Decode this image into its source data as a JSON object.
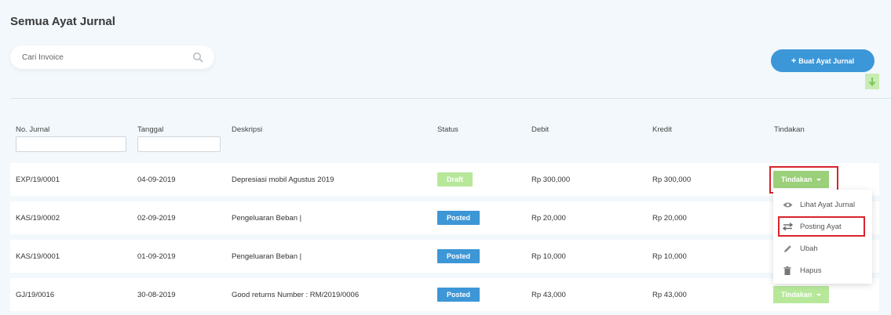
{
  "page": {
    "title": "Semua Ayat Jurnal"
  },
  "search": {
    "placeholder": "Cari Invoice",
    "icon": "search-icon"
  },
  "toolbar": {
    "create_label": "Buat Ayat Jurnal",
    "download_icon": "arrow-down-icon"
  },
  "table": {
    "columns": [
      "No. Jurnal",
      "Tanggal",
      "Deskripsi",
      "Status",
      "Debit",
      "Kredit",
      "Tindakan"
    ],
    "rows": [
      {
        "no": "EXP/19/0001",
        "date": "04-09-2019",
        "desc": "Depresiasi mobil Agustus 2019",
        "status": "Draft",
        "debit": "Rp 300,000",
        "credit": "Rp 300,000",
        "action": "Tindakan"
      },
      {
        "no": "KAS/19/0002",
        "date": "02-09-2019",
        "desc": "Pengeluaran Beban |",
        "status": "Posted",
        "debit": "Rp 20,000",
        "credit": "Rp 20,000"
      },
      {
        "no": "KAS/19/0001",
        "date": "01-09-2019",
        "desc": "Pengeluaran Beban |",
        "status": "Posted",
        "debit": "Rp 10,000",
        "credit": "Rp 10,000"
      },
      {
        "no": "GJ/19/0016",
        "date": "30-08-2019",
        "desc": "Good returns Number : RM/2019/0006",
        "status": "Posted",
        "debit": "Rp 43,000",
        "credit": "Rp 43,000",
        "action": "Tindakan"
      }
    ]
  },
  "action_menu": {
    "items": [
      {
        "label": "Lihat Ayat Jurnal",
        "icon": "eye-icon"
      },
      {
        "label": "Posting Ayat",
        "icon": "swap-arrows-icon"
      },
      {
        "label": "Ubah",
        "icon": "pencil-icon"
      },
      {
        "label": "Hapus",
        "icon": "trash-icon"
      }
    ]
  },
  "colors": {
    "primary": "#3c97d9",
    "posted": "#3d96d6",
    "draft": "#b7e89a",
    "action": "#9bd07a",
    "highlight": "#d8242d"
  }
}
